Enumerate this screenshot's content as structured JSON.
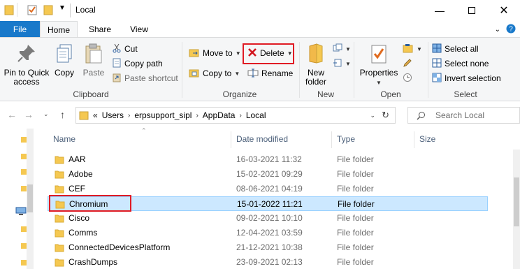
{
  "window": {
    "title": "Local",
    "controls": [
      "minimize",
      "maximize",
      "close"
    ]
  },
  "ribbon_tabs": {
    "file": "File",
    "home": "Home",
    "share": "Share",
    "view": "View"
  },
  "clipboard": {
    "pin_line1": "Pin to Quick",
    "pin_line2": "access",
    "copy": "Copy",
    "paste": "Paste",
    "cut": "Cut",
    "copy_path": "Copy path",
    "paste_shortcut": "Paste shortcut",
    "label": "Clipboard"
  },
  "organize": {
    "move_to": "Move to",
    "copy_to": "Copy to",
    "delete": "Delete",
    "rename": "Rename",
    "label": "Organize"
  },
  "new_group": {
    "new_folder_line1": "New",
    "new_folder_line2": "folder",
    "label": "New"
  },
  "open_group": {
    "properties": "Properties",
    "label": "Open"
  },
  "select_group": {
    "select_all": "Select all",
    "select_none": "Select none",
    "invert_selection": "Invert selection",
    "label": "Select"
  },
  "address": {
    "overflow": "«",
    "crumbs": [
      "Users",
      "erpsupport_sipl",
      "AppData",
      "Local"
    ]
  },
  "search": {
    "placeholder": "Search Local"
  },
  "columns": {
    "name": "Name",
    "date": "Date modified",
    "type": "Type",
    "size": "Size"
  },
  "files": [
    {
      "name": "AAR",
      "date": "16-03-2021 11:32",
      "type": "File folder"
    },
    {
      "name": "Adobe",
      "date": "15-02-2021 09:29",
      "type": "File folder"
    },
    {
      "name": "CEF",
      "date": "08-06-2021 04:19",
      "type": "File folder"
    },
    {
      "name": "Chromium",
      "date": "15-01-2022 11:21",
      "type": "File folder",
      "selected": true
    },
    {
      "name": "Cisco",
      "date": "09-02-2021 10:10",
      "type": "File folder"
    },
    {
      "name": "Comms",
      "date": "12-04-2021 03:59",
      "type": "File folder"
    },
    {
      "name": "ConnectedDevicesPlatform",
      "date": "21-12-2021 10:38",
      "type": "File folder"
    },
    {
      "name": "CrashDumps",
      "date": "23-09-2021 02:13",
      "type": "File folder"
    }
  ],
  "colors": {
    "accent": "#1979ca",
    "highlight_box": "#e01b24",
    "selection": "#cce8ff",
    "folder": "#f5c851"
  }
}
